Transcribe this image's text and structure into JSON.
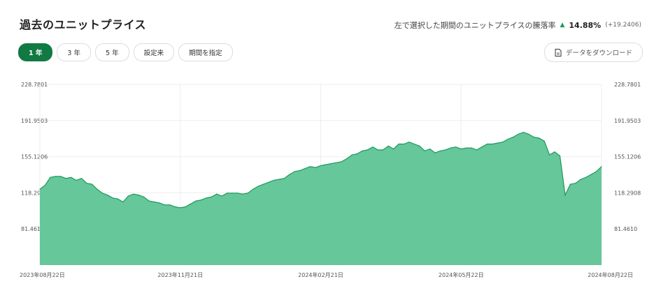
{
  "page": {
    "title": "過去のユニットプライス",
    "performance_label": "左で選択した期間のユニットプライスの騰落率",
    "performance_arrow": "▲",
    "performance_pct": "14.88%",
    "performance_delta": "(+19.2406)",
    "download_label": "データをダウンロード",
    "accent_color": "#117a43",
    "fill_color": "#66c79a",
    "line_color": "#1a9a5a"
  },
  "tabs": [
    {
      "label": "1 年",
      "active": true
    },
    {
      "label": "3 年",
      "active": false
    },
    {
      "label": "5 年",
      "active": false
    },
    {
      "label": "設定来",
      "active": false
    },
    {
      "label": "期間を指定",
      "active": false
    }
  ],
  "chart_data": {
    "type": "area",
    "title": "",
    "xlabel": "",
    "ylabel": "",
    "ylim": [
      44.63,
      228.7801
    ],
    "y_ticks": [
      "228.7801",
      "191.9503",
      "155.1206",
      "118.2908",
      "81.4610"
    ],
    "y_tick_values": [
      228.7801,
      191.9503,
      155.1206,
      118.2908,
      81.461
    ],
    "x_ticks": [
      "2023年08月22日",
      "2023年11月21日",
      "2024年02月21日",
      "2024年05月22日",
      "2024年08月22日"
    ],
    "grid": true,
    "series": [
      {
        "values": [
          122,
          126,
          134,
          135,
          135,
          133,
          134,
          131,
          133,
          128,
          127,
          122,
          118,
          116,
          113,
          112,
          109,
          115,
          117,
          116,
          114,
          110,
          109,
          108,
          106,
          106,
          104,
          103,
          104,
          107,
          110,
          111,
          113,
          114,
          117,
          115,
          118,
          118,
          118,
          117,
          118,
          122,
          125,
          127,
          129,
          131,
          132,
          133,
          137,
          140,
          141,
          143,
          145,
          144,
          146,
          147,
          148,
          149,
          150,
          153,
          157,
          158,
          161,
          162,
          165,
          162,
          162,
          166,
          163,
          168,
          168,
          170,
          168,
          166,
          161,
          163,
          159,
          161,
          162,
          164,
          165,
          163,
          164,
          164,
          162,
          165,
          168,
          168,
          169,
          170,
          173,
          175,
          178,
          180,
          178,
          175,
          174,
          171,
          157,
          160,
          156,
          116,
          127,
          128,
          132,
          134,
          137,
          140,
          145
        ]
      }
    ]
  }
}
